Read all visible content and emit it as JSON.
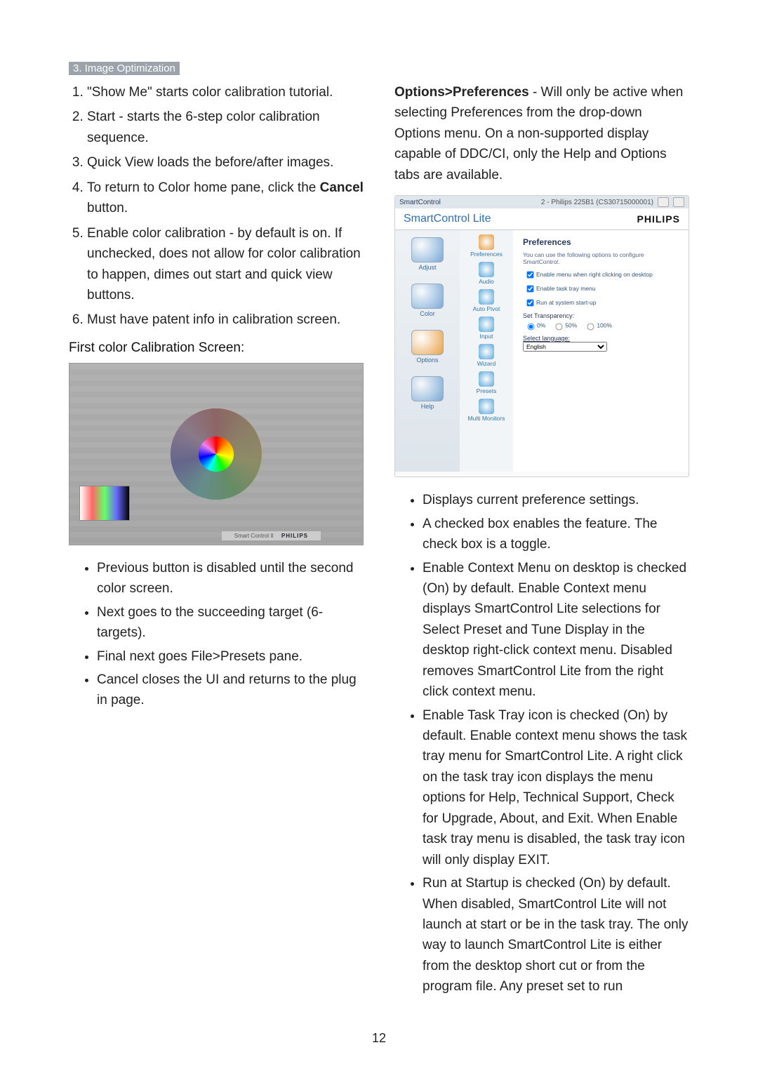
{
  "header": "3. Image Optimization",
  "page_number": "12",
  "left": {
    "steps": [
      "\"Show Me\" starts color calibration tutorial.",
      "Start - starts the 6-step color calibration sequence.",
      "Quick View loads the before/after images.",
      "To return to Color home pane, click the <b class='semi'>Cancel</b> button.",
      "Enable color calibration - by default is on. If unchecked, does not allow for color calibration to happen, dimes out start and quick view buttons.",
      "Must have patent info in calibration screen."
    ],
    "subhead": "First color Calibration Screen:",
    "cal_footer_left": "Smart Control II",
    "cal_footer_brand": "PHILIPS",
    "bullets": [
      "Previous button is disabled until the second color screen.",
      "Next goes to the succeeding target (6-targets).",
      "Final next goes File>Presets pane.",
      "Cancel closes the UI and returns to the plug in page."
    ]
  },
  "right": {
    "intro": "<b class='semi'>Options>Preferences</b> - Will only be active when selecting Preferences from the drop-down Options menu. On a non-supported display capable of DDC/CI, only the Help and Options tabs are available.",
    "window": {
      "titlebar_left": "SmartControl",
      "titlebar_right": "2 - Philips 225B1 (CS30715000001)",
      "app_title": "SmartControl Lite",
      "brand": "PHILIPS",
      "left_tabs": [
        {
          "label": "Adjust",
          "selected": false
        },
        {
          "label": "Color",
          "selected": false
        },
        {
          "label": "Options",
          "selected": true
        },
        {
          "label": "Help",
          "selected": false
        }
      ],
      "mid_items": [
        {
          "label": "Preferences",
          "selected": true
        },
        {
          "label": "Audio"
        },
        {
          "label": "Auto Pivot"
        },
        {
          "label": "Input"
        },
        {
          "label": "Wizard"
        },
        {
          "label": "Presets"
        },
        {
          "label": "Multi Monitors"
        }
      ],
      "panel": {
        "title": "Preferences",
        "desc": "You can use the following options to configure SmartControl.",
        "checks": [
          "Enable menu when right clicking on desktop",
          "Enable task tray menu",
          "Run at system start-up"
        ],
        "transparency_label": "Set Transparency:",
        "transparency_options": [
          "0%",
          "50%",
          "100%"
        ],
        "transparency_selected": "0%",
        "language_label": "Select language:",
        "language_value": "English"
      }
    },
    "bullets": [
      "Displays current preference settings.",
      "A checked box enables the feature. The check box is a toggle.",
      "Enable Context Menu on desktop is checked (On) by default. Enable Context menu displays SmartControl Lite selections for Select Preset and Tune Display in the desktop right-click context menu. Disabled removes SmartControl Lite from the right click context menu.",
      "Enable Task Tray icon is checked (On) by default. Enable context menu shows the task tray menu for SmartControl Lite. A right click on the task tray icon displays the menu options for Help, Technical Support, Check for Upgrade, About, and Exit. When Enable task tray menu is disabled, the task tray icon will only display EXIT.",
      "Run at Startup is checked (On) by default. When disabled, SmartControl Lite will not launch at start or be in the task tray. The only way to launch SmartControl Lite is either from the desktop short cut or from the program file. Any preset set to run"
    ]
  }
}
